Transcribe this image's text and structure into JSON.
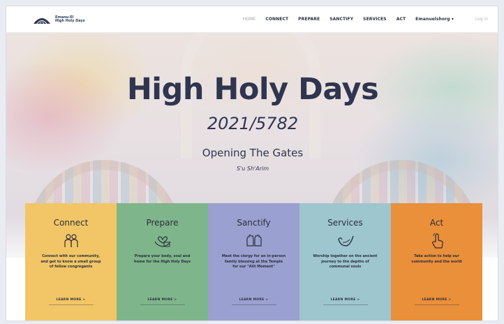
{
  "colors": {
    "navy": "#2f3550",
    "connect": "#f2c666",
    "prepare": "#7fb58a",
    "sanctify": "#9aa0cf",
    "services": "#9ec6ce",
    "act": "#ea8f3a"
  },
  "header": {
    "brand_line1": "Emanu-El",
    "brand_line2": "High Holy Days",
    "nav": [
      {
        "label": "HOME",
        "active": true
      },
      {
        "label": "CONNECT"
      },
      {
        "label": "PREPARE"
      },
      {
        "label": "SANCTIFY"
      },
      {
        "label": "SERVICES"
      },
      {
        "label": "ACT"
      },
      {
        "label": "Emanuelshorg ▾"
      }
    ],
    "login": "Log in"
  },
  "hero": {
    "title": "High Holy Days",
    "year": "2021/5782",
    "subtitle": "Opening The Gates",
    "hebrew": "S'u Sh'Arim"
  },
  "cards": [
    {
      "title": "Connect",
      "icon": "people-icon",
      "description": "Connect with our community, and get to know a small group of fellow congregants",
      "link": "LEARN MORE >"
    },
    {
      "title": "Prepare",
      "icon": "heart-hands-icon",
      "description": "Prepare your body, soul and home for the High Holy Days",
      "link": "LEARN MORE >"
    },
    {
      "title": "Sanctify",
      "icon": "blessing-hands-icon",
      "description": "Meet the clergy for an in-person family blessing at the Temple for our \"Aiit Moment\"",
      "link": "LEARN MORE >"
    },
    {
      "title": "Services",
      "icon": "shofar-icon",
      "description": "Worship together on the ancient journey to the depths of communal souls",
      "link": "LEARN MORE >"
    },
    {
      "title": "Act",
      "icon": "hand-pointer-icon",
      "description": "Take action to help our community and the world",
      "link": "LEARN MORE >"
    }
  ]
}
